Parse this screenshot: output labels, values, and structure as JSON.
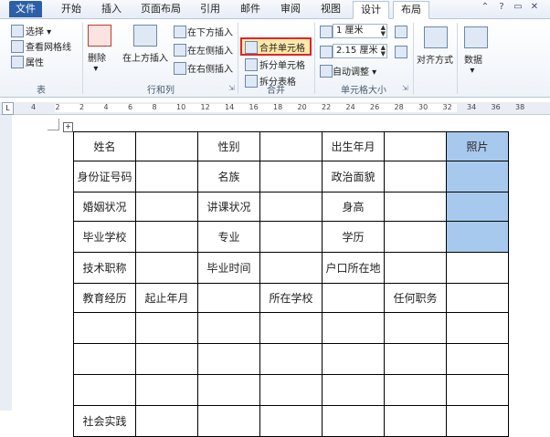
{
  "tabs": [
    "文件",
    "开始",
    "插入",
    "页面布局",
    "引用",
    "邮件",
    "审阅",
    "视图",
    "设计",
    "布局"
  ],
  "ribbon": {
    "table_group": {
      "select": "选择",
      "gridlines": "查看网格线",
      "properties": "属性",
      "label": "表"
    },
    "rows_cols_group": {
      "delete": "删除",
      "insert_above": "在上方插入",
      "insert_below": "在下方插入",
      "insert_left": "在左侧插入",
      "insert_right": "在右侧插入",
      "label": "行和列"
    },
    "merge_group": {
      "merge_cells": "合并单元格",
      "split_cells": "拆分单元格",
      "split_table": "拆分表格",
      "label": "合并"
    },
    "cell_size_group": {
      "height": "1 厘米",
      "width": "2.15 厘米",
      "autofit": "自动调整",
      "label": "单元格大小"
    },
    "alignment": "对齐方式",
    "data": "数据"
  },
  "ruler": {
    "numbers": [
      "4",
      "2",
      "2",
      "4",
      "6",
      "8",
      "10",
      "12",
      "14",
      "16",
      "18",
      "20",
      "22",
      "24",
      "26",
      "28",
      "30",
      "32",
      "34",
      "36",
      "38"
    ]
  },
  "table": {
    "rows": [
      [
        "姓名",
        "",
        "性别",
        "",
        "出生年月",
        "",
        "照片"
      ],
      [
        "身份证号码",
        "",
        "名族",
        "",
        "政治面貌",
        "",
        ""
      ],
      [
        "婚姻状况",
        "",
        "讲课状况",
        "",
        "身高",
        "",
        ""
      ],
      [
        "毕业学校",
        "",
        "专业",
        "",
        "学历",
        "",
        ""
      ],
      [
        "技术职称",
        "",
        "毕业时间",
        "",
        "户口所在地",
        "",
        ""
      ],
      [
        "教育经历",
        "起止年月",
        "",
        "所在学校",
        "",
        "任何职务",
        ""
      ],
      [
        "",
        "",
        "",
        "",
        "",
        "",
        ""
      ],
      [
        "",
        "",
        "",
        "",
        "",
        "",
        ""
      ],
      [
        "",
        "",
        "",
        "",
        "",
        "",
        ""
      ],
      [
        "社会实践",
        "",
        "",
        "",
        "",
        "",
        ""
      ]
    ]
  }
}
